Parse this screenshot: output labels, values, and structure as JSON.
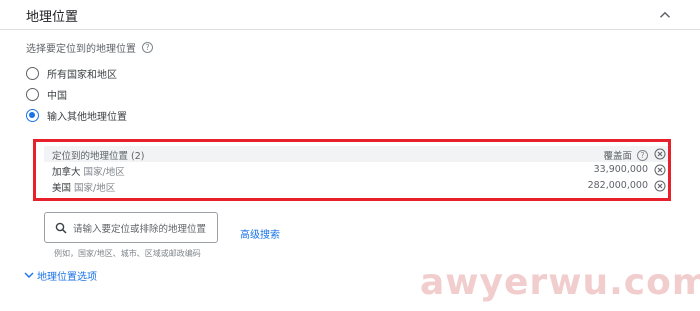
{
  "header": {
    "title": "地理位置"
  },
  "prompt": {
    "text": "选择要定位到的地理位置"
  },
  "radios": [
    {
      "label": "所有国家和地区",
      "checked": false
    },
    {
      "label": "中国",
      "checked": false
    },
    {
      "label": "输入其他地理位置",
      "checked": true
    }
  ],
  "locations": {
    "header": {
      "name": "定位到的地理位置 (2)",
      "reach": "覆盖面"
    },
    "rows": [
      {
        "name": "加拿大",
        "type": "国家/地区",
        "reach": "33,900,000"
      },
      {
        "name": "美国",
        "type": "国家/地区",
        "reach": "282,000,000"
      }
    ]
  },
  "search": {
    "placeholder": "请输入要定位或排除的地理位置",
    "advanced": "高级搜索",
    "hint": "例如，国家/地区、城市、区域或邮政编码"
  },
  "options": {
    "label": "地理位置选项"
  },
  "watermark": "awyerwu.com",
  "colors": {
    "accent": "#1a73e8",
    "highlight": "#e8202a"
  }
}
